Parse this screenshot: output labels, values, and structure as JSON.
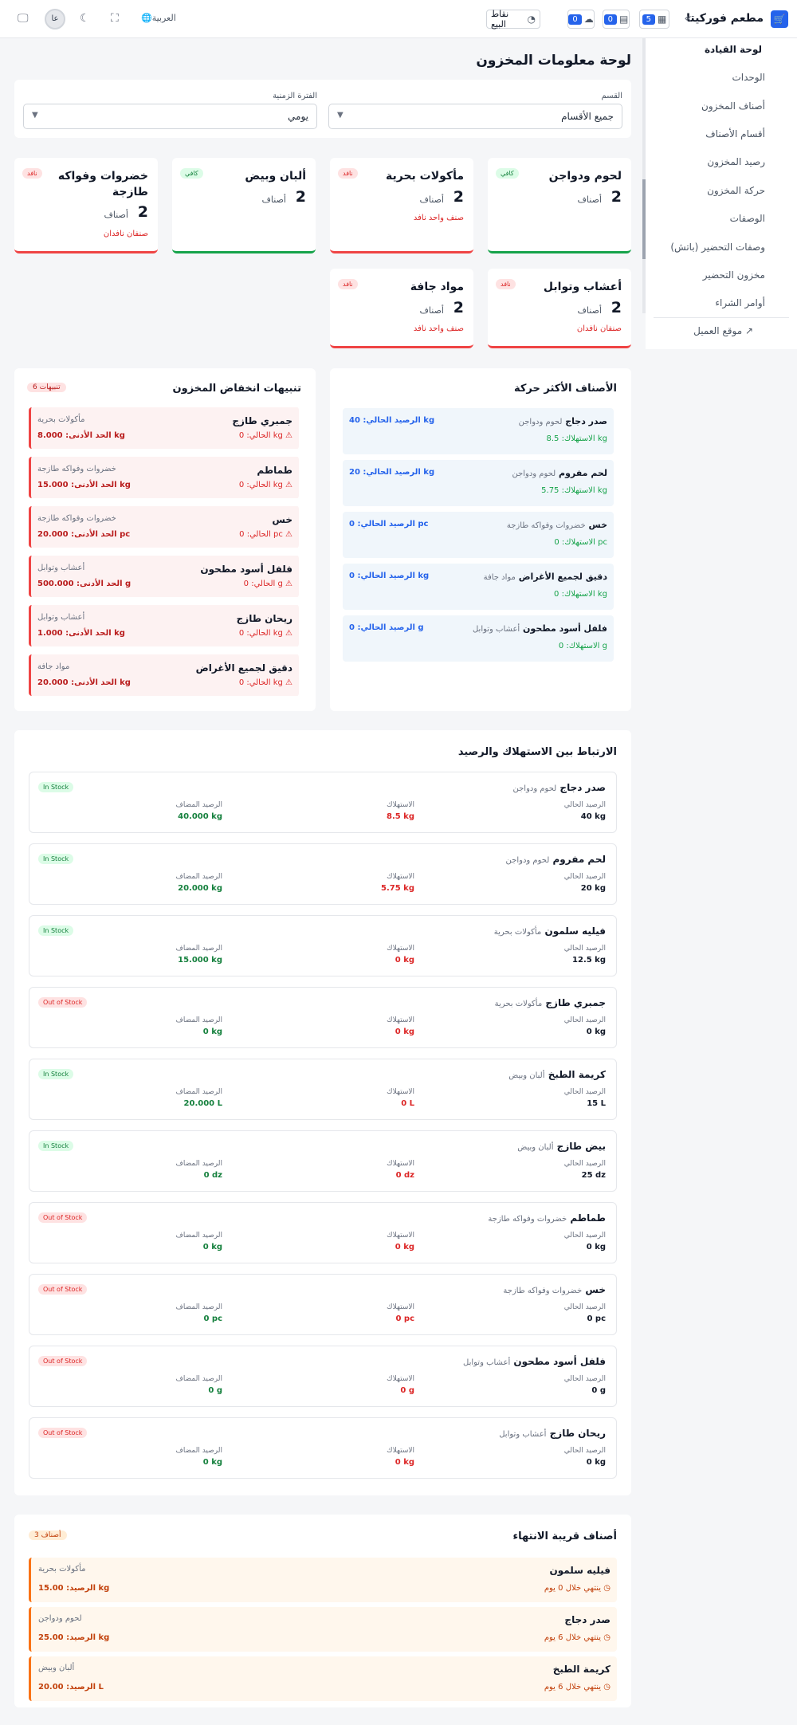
{
  "header": {
    "brand": "مطعم فوركيتا",
    "logo_icon": "🛒",
    "collapse_icon": "«",
    "notif_count_1": "5",
    "notif_count_2": "0",
    "notif_count_3": "0",
    "pos_label": "نقاط البيع",
    "language": "🌐العربية",
    "avatar": "عا"
  },
  "sidebar": {
    "items": [
      "لوحة القيادة",
      "الوحدات",
      "أصناف المخزون",
      "أقسام الأصناف",
      "رصيد المخزون",
      "حركة المخزون",
      "الوصفات",
      "وصفات التحضير (باتش)",
      "مخزون التحضير",
      "أوامر الشراء"
    ],
    "customer_site": "موقع العميل ↗"
  },
  "page": {
    "title": "لوحة معلومات المخزون"
  },
  "filters": {
    "section_label": "القسم",
    "section_value": "جميع الأقسام",
    "period_label": "الفترة الزمنية",
    "period_value": "يومي"
  },
  "categories": [
    {
      "name": "لحوم ودواجن",
      "count": "2",
      "unit": "أصناف",
      "status": "كافي",
      "warning": ""
    },
    {
      "name": "مأكولات بحرية",
      "count": "2",
      "unit": "أصناف",
      "status": "نافد",
      "warning": "صنف واحد نافد"
    },
    {
      "name": "ألبان وبيض",
      "count": "2",
      "unit": "أصناف",
      "status": "كافي",
      "warning": ""
    },
    {
      "name": "خضروات وفواكه طازجة",
      "count": "2",
      "unit": "أصناف",
      "status": "نافد",
      "warning": "صنفان نافدان"
    },
    {
      "name": "أعشاب وتوابل",
      "count": "2",
      "unit": "أصناف",
      "status": "نافد",
      "warning": "صنفان نافدان"
    },
    {
      "name": "مواد جافة",
      "count": "2",
      "unit": "أصناف",
      "status": "نافد",
      "warning": "صنف واحد نافد"
    }
  ],
  "top_moving": {
    "title": "الأصناف الأكثر حركة",
    "items": [
      {
        "name": "صدر دجاج",
        "category": "لحوم ودواجن",
        "consumption": "الاستهلاك: 8.5 kg",
        "balance": "الرصيد الحالي: 40 kg"
      },
      {
        "name": "لحم مفروم",
        "category": "لحوم ودواجن",
        "consumption": "الاستهلاك: 5.75 kg",
        "balance": "الرصيد الحالي: 20 kg"
      },
      {
        "name": "خس",
        "category": "خضروات وفواكه طازجة",
        "consumption": "الاستهلاك: 0 pc",
        "balance": "الرصيد الحالي: 0 pc"
      },
      {
        "name": "دقيق لجميع الأغراض",
        "category": "مواد جافة",
        "consumption": "الاستهلاك: 0 kg",
        "balance": "الرصيد الحالي: 0 kg"
      },
      {
        "name": "فلفل أسود مطحون",
        "category": "أعشاب وتوابل",
        "consumption": "الاستهلاك: 0 g",
        "balance": "الرصيد الحالي: 0 g"
      }
    ]
  },
  "low_stock": {
    "title": "تنبيهات انخفاض المخزون",
    "count": "6 تنبيهات",
    "items": [
      {
        "name": "جمبري طازج",
        "category": "مأكولات بحرية",
        "current": "الحالي: 0 kg",
        "min": "الحد الأدنى: 8.000 kg"
      },
      {
        "name": "طماطم",
        "category": "خضروات وفواكه طازجة",
        "current": "الحالي: 0 kg",
        "min": "الحد الأدنى: 15.000 kg"
      },
      {
        "name": "خس",
        "category": "خضروات وفواكه طازجة",
        "current": "الحالي: 0 pc",
        "min": "الحد الأدنى: 20.000 pc"
      },
      {
        "name": "فلفل أسود مطحون",
        "category": "أعشاب وتوابل",
        "current": "الحالي: 0 g",
        "min": "الحد الأدنى: 500.000 g"
      },
      {
        "name": "ريحان طازج",
        "category": "أعشاب وتوابل",
        "current": "الحالي: 0 kg",
        "min": "الحد الأدنى: 1.000 kg"
      },
      {
        "name": "دقيق لجميع الأغراض",
        "category": "مواد جافة",
        "current": "الحالي: 0 kg",
        "min": "الحد الأدنى: 20.000 kg"
      }
    ]
  },
  "correlation": {
    "title": "الارتباط بين الاستهلاك والرصيد",
    "col_current": "الرصيد الحالي",
    "col_consumption": "الاستهلاك",
    "col_added": "الرصيد المضاف",
    "items": [
      {
        "name": "صدر دجاج",
        "category": "لحوم ودواجن",
        "status": "In Stock",
        "current": "40 kg",
        "consumption": "8.5 kg",
        "added": "40.000 kg"
      },
      {
        "name": "لحم مفروم",
        "category": "لحوم ودواجن",
        "status": "In Stock",
        "current": "20 kg",
        "consumption": "5.75 kg",
        "added": "20.000 kg"
      },
      {
        "name": "فيليه سلمون",
        "category": "مأكولات بحرية",
        "status": "In Stock",
        "current": "12.5 kg",
        "consumption": "0 kg",
        "added": "15.000 kg"
      },
      {
        "name": "جمبري طازج",
        "category": "مأكولات بحرية",
        "status": "Out of Stock",
        "current": "0 kg",
        "consumption": "0 kg",
        "added": "0 kg"
      },
      {
        "name": "كريمة الطبخ",
        "category": "ألبان وبيض",
        "status": "In Stock",
        "current": "15 L",
        "consumption": "0 L",
        "added": "20.000 L"
      },
      {
        "name": "بيض طازج",
        "category": "ألبان وبيض",
        "status": "In Stock",
        "current": "25 dz",
        "consumption": "0 dz",
        "added": "0 dz"
      },
      {
        "name": "طماطم",
        "category": "خضروات وفواكه طازجة",
        "status": "Out of Stock",
        "current": "0 kg",
        "consumption": "0 kg",
        "added": "0 kg"
      },
      {
        "name": "خس",
        "category": "خضروات وفواكه طازجة",
        "status": "Out of Stock",
        "current": "0 pc",
        "consumption": "0 pc",
        "added": "0 pc"
      },
      {
        "name": "فلفل أسود مطحون",
        "category": "أعشاب وتوابل",
        "status": "Out of Stock",
        "current": "0 g",
        "consumption": "0 g",
        "added": "0 g"
      },
      {
        "name": "ريحان طازج",
        "category": "أعشاب وتوابل",
        "status": "Out of Stock",
        "current": "0 kg",
        "consumption": "0 kg",
        "added": "0 kg"
      }
    ]
  },
  "expiring": {
    "title": "أصناف قريبة الانتهاء",
    "count": "3 أصناف",
    "items": [
      {
        "name": "فيليه سلمون",
        "category": "مأكولات بحرية",
        "days": "ينتهي خلال 0 يوم",
        "balance": "الرصيد: 15.00 kg"
      },
      {
        "name": "صدر دجاج",
        "category": "لحوم ودواجن",
        "days": "ينتهي خلال 6 يوم",
        "balance": "الرصيد: 25.00 kg"
      },
      {
        "name": "كريمة الطبخ",
        "category": "ألبان وبيض",
        "days": "ينتهي خلال 6 يوم",
        "balance": "الرصيد: 20.00 L"
      }
    ]
  },
  "colors": {
    "accent": "#2563eb",
    "ok": "#16a34a",
    "danger": "#ef4444",
    "warn": "#f97316"
  }
}
